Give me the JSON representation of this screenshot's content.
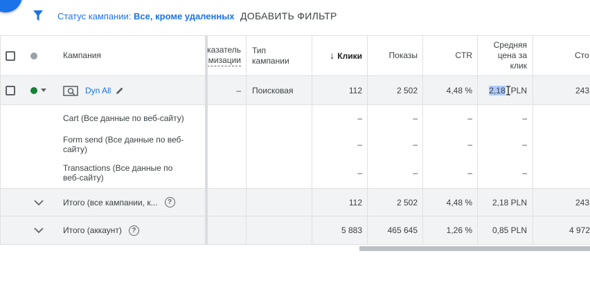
{
  "filter_bar": {
    "status_label": "Статус кампании: ",
    "status_value": "Все, кроме удаленных",
    "add_filter": "ДОБАВИТЬ ФИЛЬТР"
  },
  "header": {
    "campaign": "Кампания",
    "indicator_line1": "казатель",
    "indicator_line2": "имизации",
    "type_line1": "Тип",
    "type_line2": "кампании",
    "clicks": "Клики",
    "clicks_arrow": "↓",
    "impressions": "Показы",
    "ctr": "CTR",
    "cpc_line1": "Средняя",
    "cpc_line2": "цена за",
    "cpc_line3": "клик",
    "cost": "Сто"
  },
  "campaign_row": {
    "name": "Dyn All",
    "indicator": "–",
    "type": "Поисковая",
    "clicks": "112",
    "impressions": "2 502",
    "ctr": "4,48 %",
    "cpc_selected": "2,18",
    "cpc_unit": "PLN",
    "cost": "243"
  },
  "conversion_rows": [
    {
      "name_line1": "Cart (Все данные по веб-сайту)",
      "name_line2": "",
      "clicks": "–",
      "impressions": "–",
      "ctr": "–",
      "cpc": "–"
    },
    {
      "name_line1": "Form send (Все данные по веб-",
      "name_line2": "сайту)",
      "clicks": "–",
      "impressions": "–",
      "ctr": "–",
      "cpc": "–"
    },
    {
      "name_line1": "Transactions (Все данные по",
      "name_line2": "веб-сайту)",
      "clicks": "–",
      "impressions": "–",
      "ctr": "–",
      "cpc": "–"
    }
  ],
  "total_campaigns": {
    "label": "Итого (все кампании, к...",
    "clicks": "112",
    "impressions": "2 502",
    "ctr": "4,48 %",
    "cpc": "2,18 PLN",
    "cost": "243"
  },
  "total_account": {
    "label": "Итого (аккаунт)",
    "clicks": "5 883",
    "impressions": "465 645",
    "ctr": "1,26 %",
    "cpc": "0,85 PLN",
    "cost": "4 972"
  },
  "colors": {
    "accent": "#1a73e8",
    "status_enabled": "#188038"
  }
}
